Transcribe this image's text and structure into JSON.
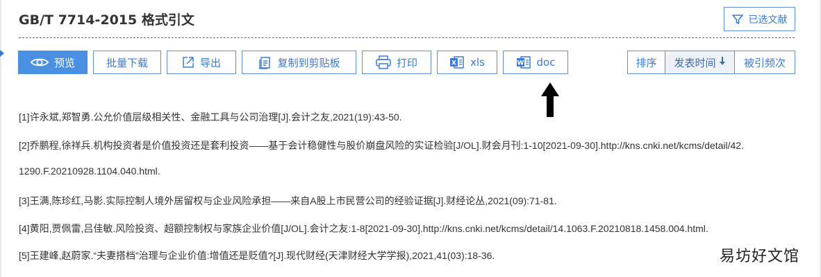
{
  "header": {
    "title": "GB/T 7714-2015 格式引文",
    "selected_docs_label": "已选文献"
  },
  "toolbar": {
    "preview_label": "预览",
    "batch_download_label": "批量下载",
    "export_label": "导出",
    "copy_label": "复制到剪贴板",
    "print_label": "打印",
    "xls_label": "xls",
    "doc_label": "doc"
  },
  "sort": {
    "label": "排序",
    "options": [
      "发表时间",
      "被引频次"
    ],
    "active": "发表时间",
    "active_direction": "down"
  },
  "references": [
    "[1]许永斌,郑智勇.公允价值层级相关性、金融工具与公司治理[J].会计之友,2021(19):43-50.",
    "[2]乔鹏程,徐祥兵.机构投资者是价值投资还是套利投资——基于会计稳健性与股价崩盘风险的实证检验[J/OL].财会月刊:1-10[2021-09-30].http://kns.cnki.net/kcms/detail/42.",
    "1290.F.20210928.1104.040.html.",
    "[3]王满,陈珍红,马影.实际控制人境外居留权与企业风险承担——来自A股上市民营公司的经验证据[J].财经论丛,2021(09):71-81.",
    "[4]黄阳,贾佩雷,吕佳敏.风险投资、超额控制权与家族企业价值[J/OL].会计之友:1-8[2021-09-30].http://kns.cnki.net/kcms/detail/14.1063.F.20210818.1458.004.html.",
    "[5]王建峰,赵蔚家.“夫妻搭档”治理与企业价值:增值还是贬值?[J].现代财经(天津财经大学学报),2021,41(03):18-36."
  ],
  "watermark": "易坊好文馆",
  "colors": {
    "accent": "#4a90e2",
    "border": "#5b8fd8"
  }
}
